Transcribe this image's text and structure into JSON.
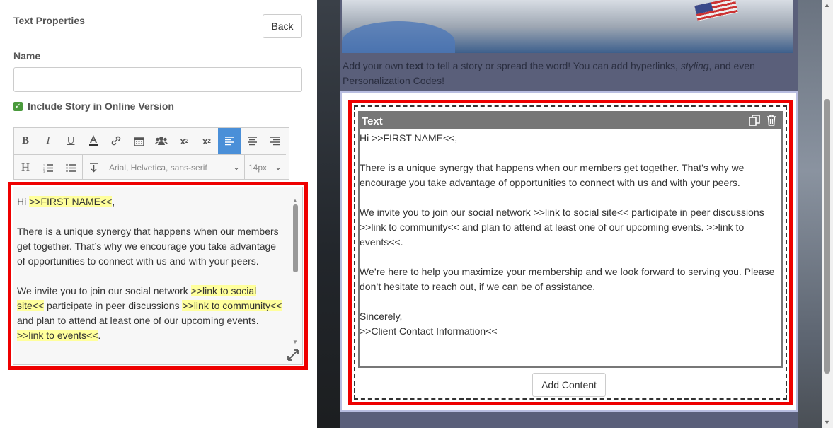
{
  "panel": {
    "title": "Text Properties",
    "back_label": "Back",
    "name_label": "Name",
    "name_value": "",
    "include_label": "Include Story in Online Version",
    "include_checked": true
  },
  "toolbar": {
    "font_family": "Arial, Helvetica, sans-serif",
    "font_size": "14px",
    "active_color": "#4a8fd8"
  },
  "editor": {
    "greeting_pre": "Hi ",
    "greeting_code": ">>FIRST NAME<<",
    "greeting_post": ",",
    "p1": "There is a unique synergy that happens when our members get together.  That’s why we encourage you take advantage of opportunities to connect with us and with your peers.",
    "p2_a": "We invite you to join our social network ",
    "p2_code1": ">>link to social site<<",
    "p2_b": " participate in peer discussions ",
    "p2_code2": ">>link to community<<",
    "p2_c": " and plan to attend at least one of our upcoming events.   ",
    "p2_code3": ">>link to events<<",
    "p2_d": "."
  },
  "preview": {
    "intro_a": "Add your own ",
    "intro_bold": "text",
    "intro_b": " to tell a story or spread the word! You can add hyperlinks, ",
    "intro_italic": "styling",
    "intro_c": ", and even Personalization Codes!",
    "widget_title": "Text",
    "body": [
      "Hi >>FIRST NAME<<,",
      "There is a unique synergy that happens when our members get together. That’s why we encourage you take advantage of opportunities to connect with us and with your peers.",
      "We invite you to join our social network >>link to social site<< participate in peer discussions >>link to community<< and plan to attend at least one of our upcoming events. >>link to events<<.",
      "We’re here to help you maximize your membership and we look forward to serving you. Please don’t hesitate to reach out, if we can be of assistance.",
      "Sincerely,",
      ">>Client Contact Information<<"
    ],
    "add_content_label": "Add Content"
  }
}
